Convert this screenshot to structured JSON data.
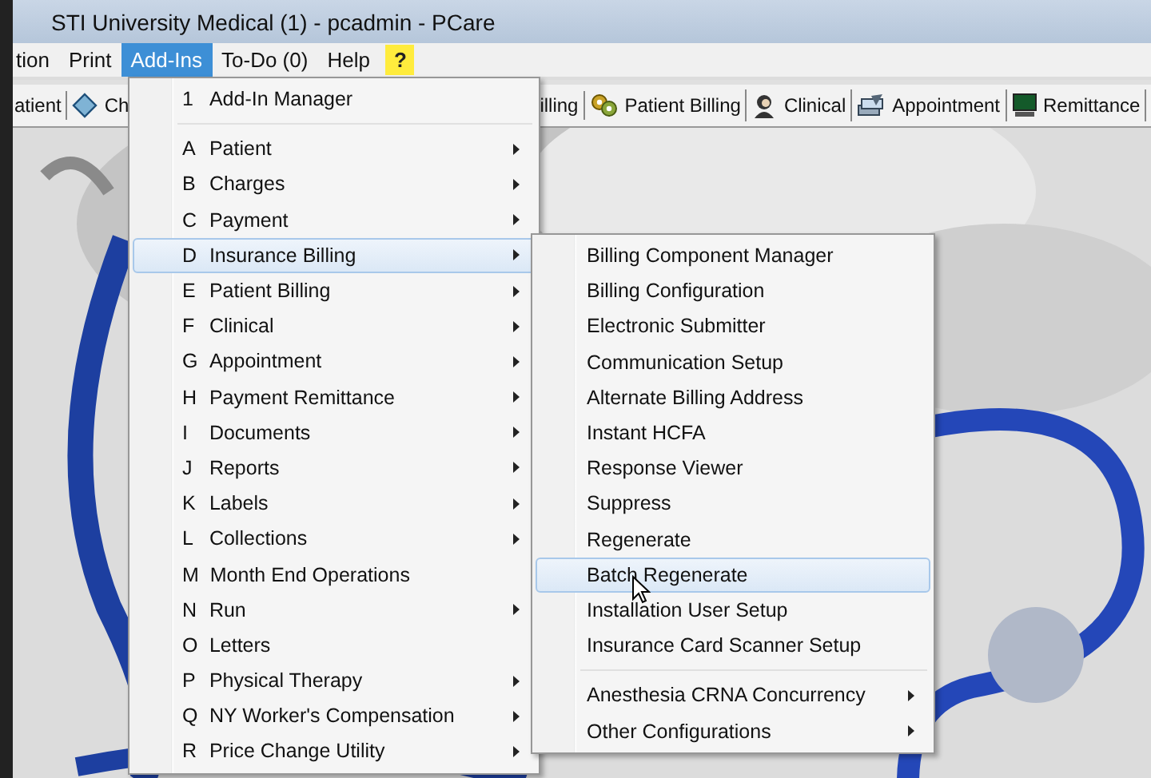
{
  "window": {
    "title": "STI University Medical (1) - pcadmin - PCare"
  },
  "menubar": [
    {
      "label": "tion",
      "selected": false
    },
    {
      "label": "Print",
      "selected": false
    },
    {
      "label": "Add-Ins",
      "selected": true
    },
    {
      "label": "To-Do (0)",
      "selected": false
    },
    {
      "label": "Help",
      "selected": false
    },
    {
      "label": "?",
      "selected": false,
      "kind": "help"
    }
  ],
  "toolbar": [
    {
      "label": "atient"
    },
    {
      "label": "Ch"
    },
    {
      "label": "illing"
    },
    {
      "label": "Patient Billing"
    },
    {
      "label": "Clinical"
    },
    {
      "label": "Appointment"
    },
    {
      "label": "Remittance"
    }
  ],
  "addins_menu": [
    {
      "kind": "item",
      "key": "1",
      "label": "Add-In Manager",
      "has_submenu": false,
      "selected": false
    },
    {
      "kind": "separator"
    },
    {
      "kind": "item",
      "key": "A",
      "label": "Patient",
      "has_submenu": true,
      "selected": false
    },
    {
      "kind": "item",
      "key": "B",
      "label": "Charges",
      "has_submenu": true,
      "selected": false
    },
    {
      "kind": "item",
      "key": "C",
      "label": "Payment",
      "has_submenu": true,
      "selected": false
    },
    {
      "kind": "item",
      "key": "D",
      "label": "Insurance Billing",
      "has_submenu": true,
      "selected": true
    },
    {
      "kind": "item",
      "key": "E",
      "label": "Patient Billing",
      "has_submenu": true,
      "selected": false
    },
    {
      "kind": "item",
      "key": "F",
      "label": "Clinical",
      "has_submenu": true,
      "selected": false
    },
    {
      "kind": "item",
      "key": "G",
      "label": "Appointment",
      "has_submenu": true,
      "selected": false
    },
    {
      "kind": "item",
      "key": "H",
      "label": "Payment Remittance",
      "has_submenu": true,
      "selected": false
    },
    {
      "kind": "item",
      "key": "I",
      "label": "Documents",
      "has_submenu": true,
      "selected": false
    },
    {
      "kind": "item",
      "key": "J",
      "label": "Reports",
      "has_submenu": true,
      "selected": false
    },
    {
      "kind": "item",
      "key": "K",
      "label": "Labels",
      "has_submenu": true,
      "selected": false
    },
    {
      "kind": "item",
      "key": "L",
      "label": "Collections",
      "has_submenu": true,
      "selected": false
    },
    {
      "kind": "item",
      "key": "M",
      "label": "Month End Operations",
      "has_submenu": false,
      "selected": false
    },
    {
      "kind": "item",
      "key": "N",
      "label": "Run",
      "has_submenu": true,
      "selected": false
    },
    {
      "kind": "item",
      "key": "O",
      "label": "Letters",
      "has_submenu": false,
      "selected": false
    },
    {
      "kind": "item",
      "key": "P",
      "label": "Physical Therapy",
      "has_submenu": true,
      "selected": false
    },
    {
      "kind": "item",
      "key": "Q",
      "label": "NY Worker's Compensation",
      "has_submenu": true,
      "selected": false
    },
    {
      "kind": "item",
      "key": "R",
      "label": "Price Change Utility",
      "has_submenu": true,
      "selected": false
    }
  ],
  "insurance_billing_submenu": [
    {
      "kind": "item",
      "label": "Billing Component Manager",
      "has_submenu": false,
      "selected": false
    },
    {
      "kind": "item",
      "label": "Billing Configuration",
      "has_submenu": false,
      "selected": false
    },
    {
      "kind": "item",
      "label": "Electronic Submitter",
      "has_submenu": false,
      "selected": false
    },
    {
      "kind": "item",
      "label": "Communication Setup",
      "has_submenu": false,
      "selected": false
    },
    {
      "kind": "item",
      "label": "Alternate Billing Address",
      "has_submenu": false,
      "selected": false
    },
    {
      "kind": "item",
      "label": "Instant HCFA",
      "has_submenu": false,
      "selected": false
    },
    {
      "kind": "item",
      "label": "Response Viewer",
      "has_submenu": false,
      "selected": false
    },
    {
      "kind": "item",
      "label": "Suppress",
      "has_submenu": false,
      "selected": false
    },
    {
      "kind": "item",
      "label": "Regenerate",
      "has_submenu": false,
      "selected": false
    },
    {
      "kind": "item",
      "label": "Batch Regenerate",
      "has_submenu": false,
      "selected": true
    },
    {
      "kind": "item",
      "label": "Installation User Setup",
      "has_submenu": false,
      "selected": false
    },
    {
      "kind": "item",
      "label": "Insurance Card Scanner Setup",
      "has_submenu": false,
      "selected": false
    },
    {
      "kind": "separator"
    },
    {
      "kind": "item",
      "label": "Anesthesia CRNA Concurrency",
      "has_submenu": true,
      "selected": false
    },
    {
      "kind": "item",
      "label": "Other Configurations",
      "has_submenu": true,
      "selected": false
    }
  ]
}
